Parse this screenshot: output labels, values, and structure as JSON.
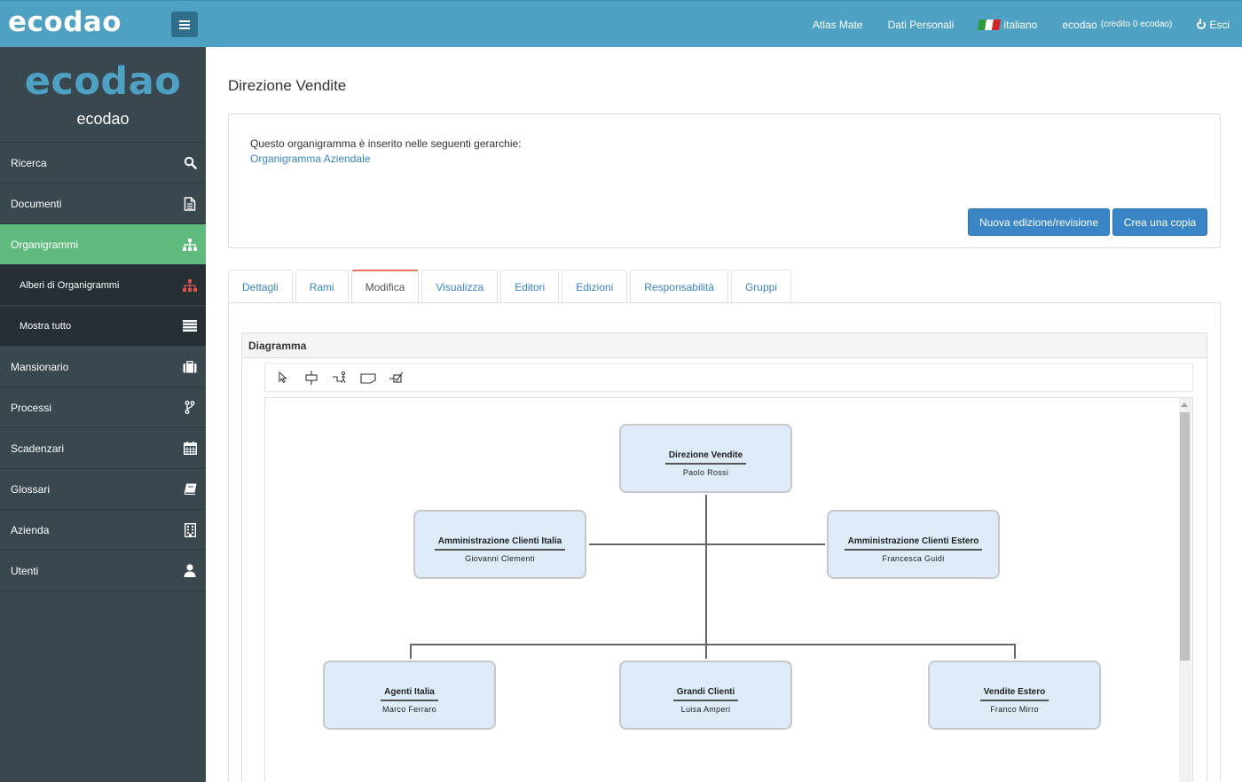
{
  "topbar": {
    "brand": "ecodao",
    "links": {
      "atlas": "Atlas Mate",
      "personal": "Dati Personali",
      "language": "italiano",
      "account": "ecodao",
      "credit": "(credito 0 ecodao)",
      "logout": "Esci"
    }
  },
  "sidebar": {
    "logo": "ecodao",
    "name": "ecodao",
    "items": [
      {
        "label": "Ricerca",
        "icon": "search-icon"
      },
      {
        "label": "Documenti",
        "icon": "document-icon"
      },
      {
        "label": "Organigrammi",
        "icon": "sitemap-icon"
      },
      {
        "label": "Alberi di Organigrammi",
        "icon": "sitemap-icon"
      },
      {
        "label": "Mostra tutto",
        "icon": "list-icon"
      },
      {
        "label": "Mansionario",
        "icon": "briefcase-icon"
      },
      {
        "label": "Processi",
        "icon": "branch-icon"
      },
      {
        "label": "Scadenzari",
        "icon": "calendar-icon"
      },
      {
        "label": "Glossari",
        "icon": "book-icon"
      },
      {
        "label": "Azienda",
        "icon": "building-icon"
      },
      {
        "label": "Utenti",
        "icon": "user-icon"
      }
    ]
  },
  "main": {
    "title": "Direzione Vendite",
    "info_text": "Questo organigramma è inserito nelle seguenti gerarchie:",
    "info_link": "Organigramma Aziendale",
    "buttons": {
      "new_edition": "Nuova edizione/revisione",
      "copy": "Crea una copia"
    },
    "tabs": [
      "Dettagli",
      "Rami",
      "Modifica",
      "Visualizza",
      "Editori",
      "Edizioni",
      "Responsabilità",
      "Gruppi"
    ],
    "active_tab": "Modifica",
    "diagram_title": "Diagramma",
    "toolbar": [
      "pointer-tool-icon",
      "node-tool-icon",
      "connector-tool-icon",
      "note-tool-icon",
      "check-tool-icon"
    ]
  },
  "diagram": {
    "nodes": [
      {
        "title": "Direzione Vendite",
        "person": "Paolo Rossi"
      },
      {
        "title": "Amministrazione Clienti Italia",
        "person": "Giovanni Clementi"
      },
      {
        "title": "Amministrazione Clienti Estero",
        "person": "Francesca Guidi"
      },
      {
        "title": "Agenti Italia",
        "person": "Marco Ferraro"
      },
      {
        "title": "Grandi Clienti",
        "person": "Luisa Amperi"
      },
      {
        "title": "Vendite Estero",
        "person": "Franco Mirro"
      }
    ]
  },
  "colors": {
    "topbar": "#4ea1c3",
    "sidebar": "#39474f",
    "active_item": "#5fbb7d",
    "primary_button": "#3a85c6",
    "node_fill": "#deecfa"
  }
}
